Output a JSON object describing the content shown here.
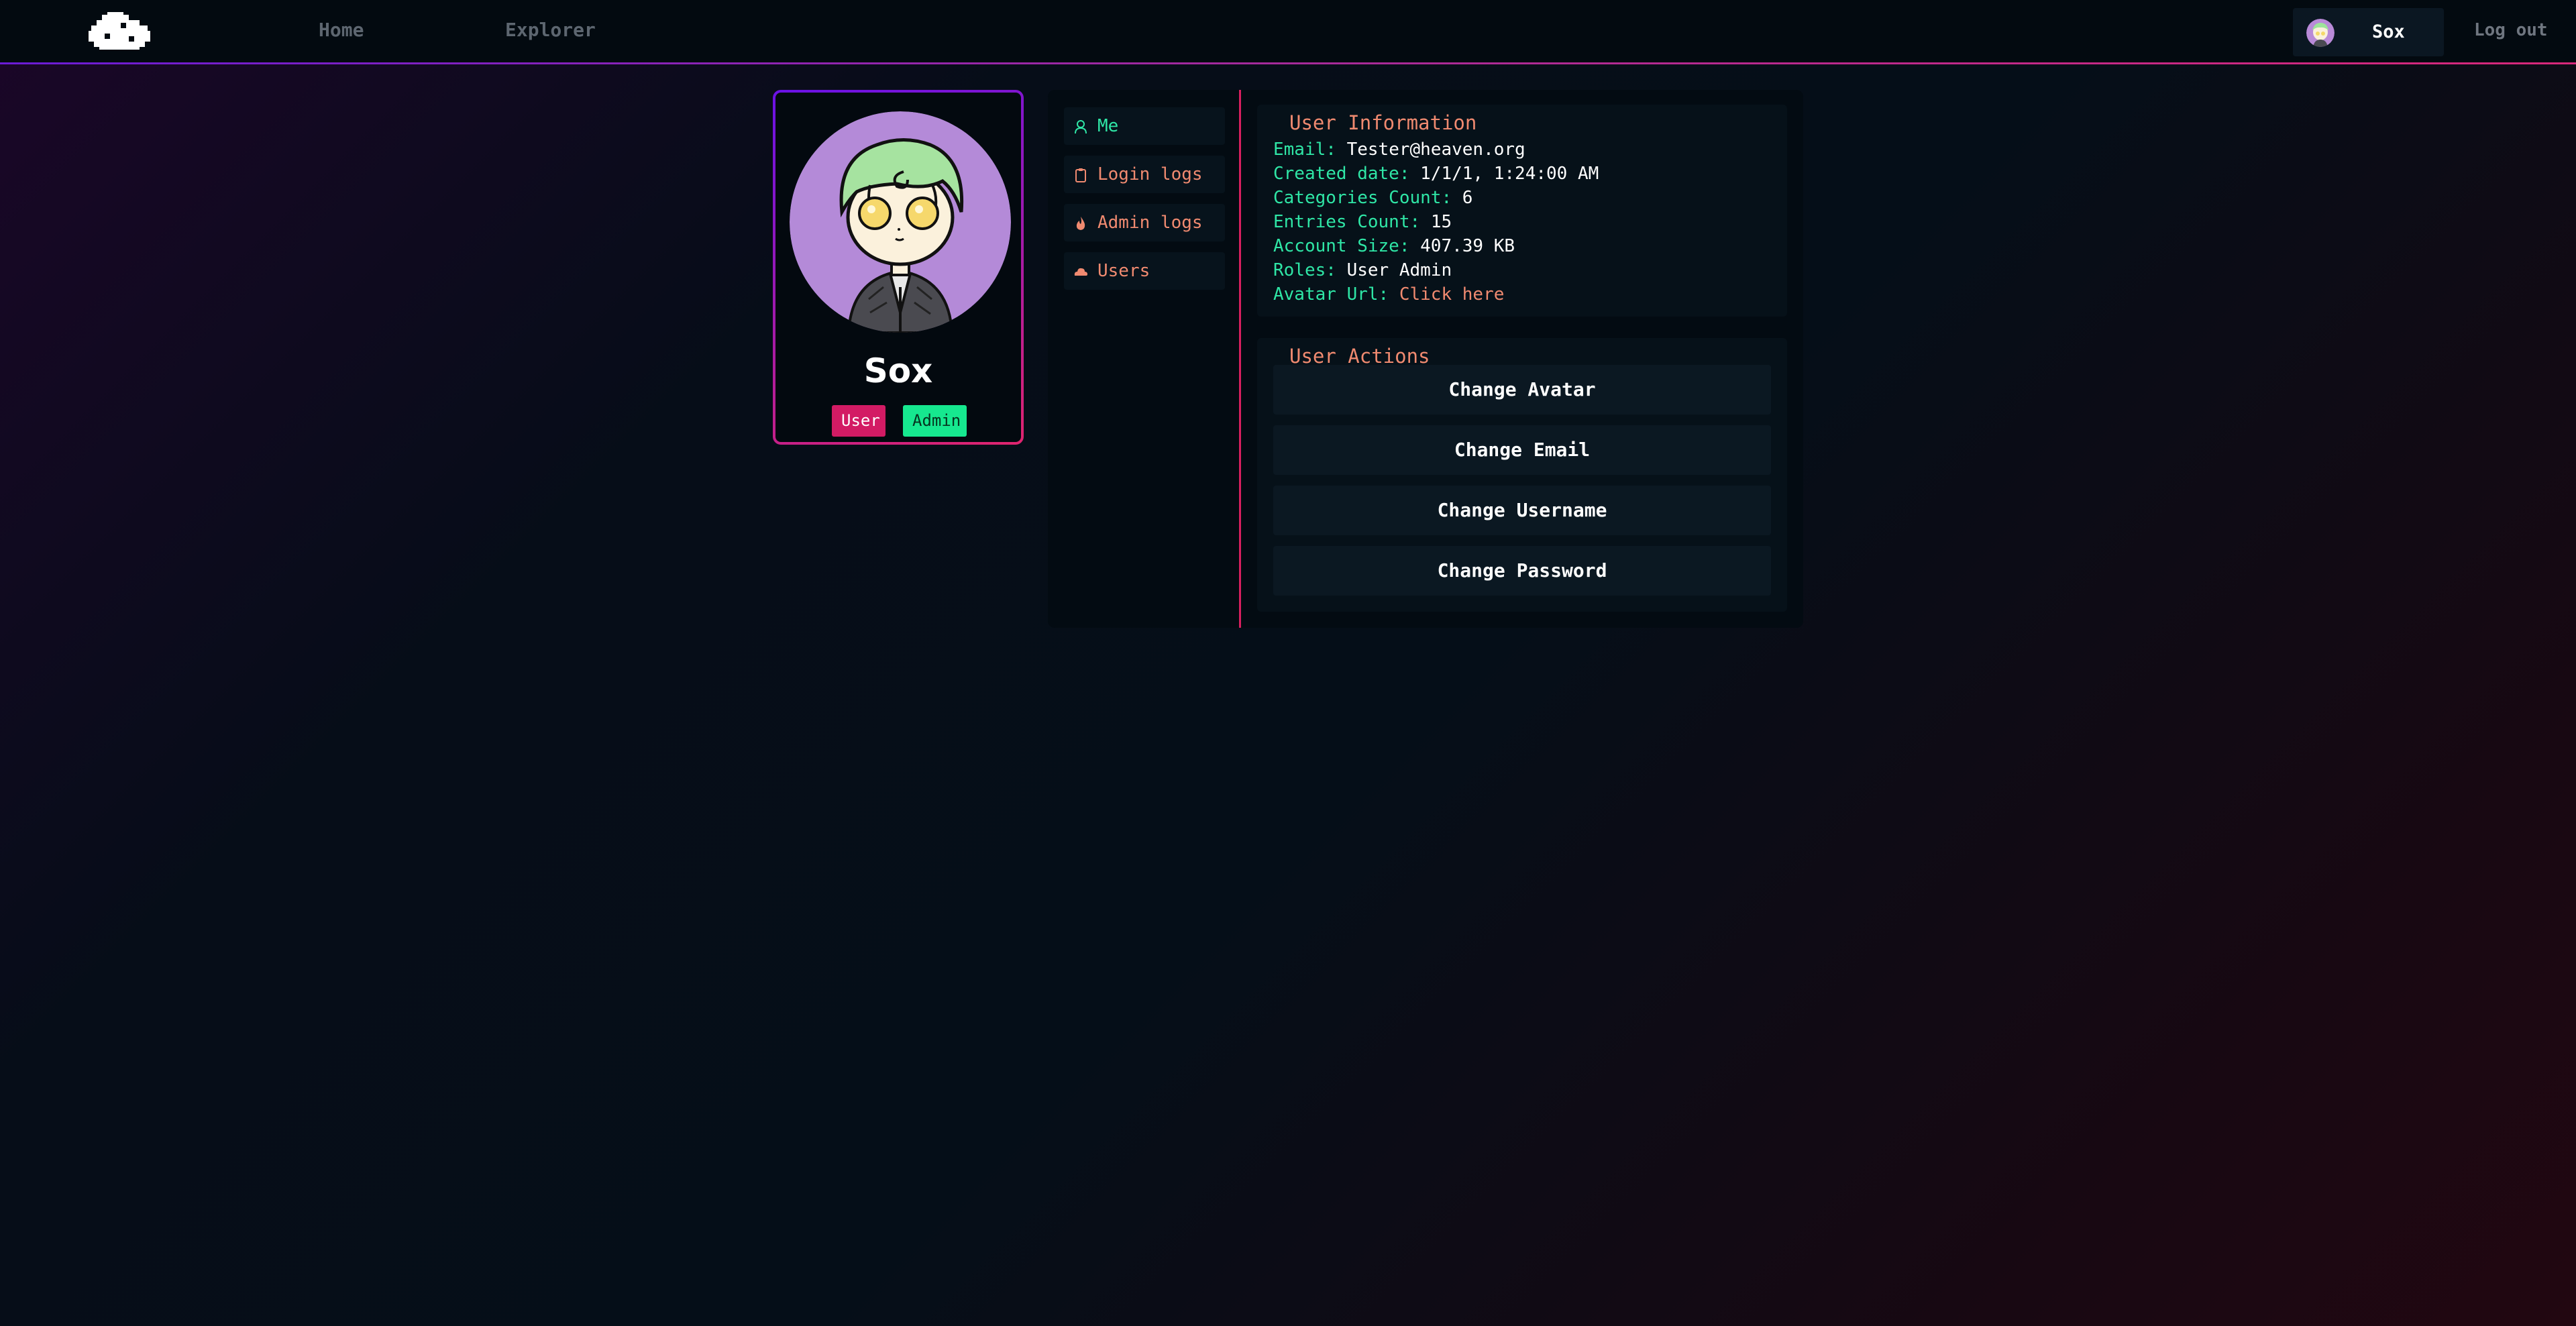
{
  "nav": {
    "home_label": "Home",
    "explorer_label": "Explorer",
    "user_name": "Sox",
    "logout_label": "Log out"
  },
  "profile": {
    "name": "Sox",
    "roles": [
      "User",
      "Admin"
    ]
  },
  "sidebar": {
    "items": [
      {
        "label": "Me",
        "icon": "user-icon"
      },
      {
        "label": "Login logs",
        "icon": "clipboard-icon"
      },
      {
        "label": "Admin logs",
        "icon": "flame-icon"
      },
      {
        "label": "Users",
        "icon": "cloud-icon"
      }
    ]
  },
  "user_info": {
    "title": "User Information",
    "rows": [
      {
        "key": "Email:",
        "value": "Tester@heaven.org"
      },
      {
        "key": "Created date:",
        "value": "1/1/1, 1:24:00 AM"
      },
      {
        "key": "Categories Count:",
        "value": "6"
      },
      {
        "key": "Entries Count:",
        "value": "15"
      },
      {
        "key": "Account Size:",
        "value": "407.39 KB"
      },
      {
        "key": "Roles:",
        "value": "User Admin"
      },
      {
        "key": "Avatar Url:",
        "value": "Click here"
      }
    ]
  },
  "user_actions": {
    "title": "User Actions",
    "buttons": [
      "Change Avatar",
      "Change Email",
      "Change Username",
      "Change Password"
    ]
  },
  "colors": {
    "accent_green": "#2fe6a6",
    "accent_salmon": "#f08a70",
    "accent_pink": "#d81f5f",
    "accent_purple": "#6a12e6"
  }
}
